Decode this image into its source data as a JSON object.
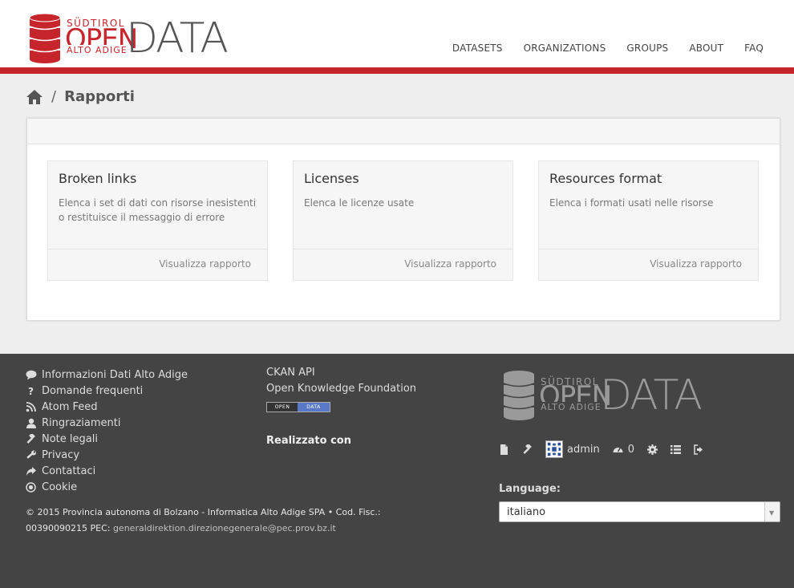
{
  "brand": {
    "line1": "SÜDTIROL",
    "line2": "OPEN",
    "line3": "ALTO ADIGE",
    "line4": "DATA",
    "color": "#c6252b"
  },
  "nav": {
    "items": [
      "DATASETS",
      "ORGANIZATIONS",
      "GROUPS",
      "ABOUT",
      "FAQ"
    ]
  },
  "breadcrumb": {
    "home_icon": "home-icon",
    "separator": "/",
    "current": "Rapporti"
  },
  "reports": [
    {
      "title": "Broken links",
      "description": "Elenca i set di dati con risorse inesistenti o restituisce il messaggio di errore",
      "action": "Visualizza rapporto"
    },
    {
      "title": "Licenses",
      "description": "Elenca le licenze usate",
      "action": "Visualizza rapporto"
    },
    {
      "title": "Resources format",
      "description": "Elenca i formati usati nelle risorse",
      "action": "Visualizza rapporto"
    }
  ],
  "footer": {
    "links": [
      {
        "icon": "comment-icon",
        "label": "Informazioni Dati Alto Adige"
      },
      {
        "icon": "question-icon",
        "label": "Domande frequenti"
      },
      {
        "icon": "rss-icon",
        "label": "Atom Feed"
      },
      {
        "icon": "user-icon",
        "label": "Ringraziamenti"
      },
      {
        "icon": "gavel-icon",
        "label": "Note legali"
      },
      {
        "icon": "wrench-icon",
        "label": "Privacy"
      },
      {
        "icon": "share-icon",
        "label": "Contattaci"
      },
      {
        "icon": "target-icon",
        "label": "Cookie"
      }
    ],
    "copyright": "© 2015 Provincia autonoma di Bolzano - Informatica Alto Adige SPA • Cod. Fisc.: 00390090215 PEC:",
    "pec_email": "generaldirektion.direzionegenerale@pec.prov.bz.it",
    "col2": {
      "api": "CKAN API",
      "okf": "Open Knowledge Foundation",
      "badge_left": "OPEN",
      "badge_right": "DATA",
      "made_with": "Realizzato con"
    },
    "account": {
      "username": "admin",
      "count": "0"
    },
    "language": {
      "label": "Language:",
      "selected": "italiano"
    }
  }
}
